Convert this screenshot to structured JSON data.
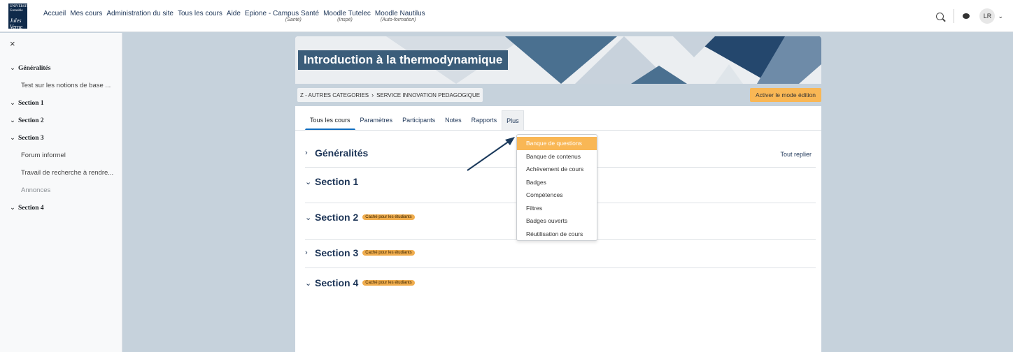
{
  "navbar": {
    "logo_line1": "UNIVERSITÉ Grenoble",
    "logo_line2": "Jules Verne",
    "items": [
      {
        "label": "Accueil",
        "sub": ""
      },
      {
        "label": "Mes cours",
        "sub": ""
      },
      {
        "label": "Administration du site",
        "sub": ""
      },
      {
        "label": "Tous les cours",
        "sub": ""
      },
      {
        "label": "Aide",
        "sub": ""
      },
      {
        "label": "Epione - Campus Santé",
        "sub": "(Santé)"
      },
      {
        "label": "Moodle Tutelec",
        "sub": "(Inspé)"
      },
      {
        "label": "Moodle Nautilus",
        "sub": "(Auto-formation)"
      }
    ],
    "user_initials": "LR",
    "icons": [
      "search-icon",
      "chat-icon",
      "chevron-down-icon"
    ]
  },
  "drawer": {
    "close_glyph": "×",
    "items": [
      {
        "label": "Généralités",
        "type": "section"
      },
      {
        "label": "Test sur les notions de base ...",
        "type": "activity"
      },
      {
        "label": "Section 1",
        "type": "section"
      },
      {
        "label": "Section 2",
        "type": "section"
      },
      {
        "label": "Section 3",
        "type": "section"
      },
      {
        "label": "Forum informel",
        "type": "activity"
      },
      {
        "label": "Travail de recherche à rendre...",
        "type": "activity"
      },
      {
        "label": "Annonces",
        "type": "muted"
      },
      {
        "label": "Section 4",
        "type": "section"
      }
    ]
  },
  "course": {
    "title": "Introduction à la thermodynamique",
    "breadcrumb": [
      "Z - AUTRES CATEGORIES",
      "SERVICE INNOVATION PEDAGOGIQUE"
    ],
    "edit_button": "Activer le mode édition",
    "tabs": [
      {
        "label": "Tous les cours"
      },
      {
        "label": "Paramètres"
      },
      {
        "label": "Participants"
      },
      {
        "label": "Notes"
      },
      {
        "label": "Rapports"
      },
      {
        "label": "Plus"
      }
    ],
    "collapse_all": "Tout replier",
    "sections": [
      {
        "name": "Généralités",
        "expanded": false,
        "badge": ""
      },
      {
        "name": "Section 1",
        "expanded": true,
        "badge": ""
      },
      {
        "name": "Section 2",
        "expanded": true,
        "badge": "Caché pour les étudiants"
      },
      {
        "name": "Section 3",
        "expanded": false,
        "badge": "Caché pour les étudiants"
      },
      {
        "name": "Section 4",
        "expanded": true,
        "badge": "Caché pour les étudiants"
      }
    ]
  },
  "dropdown": {
    "items": [
      {
        "label": "Banque de questions",
        "active": true
      },
      {
        "label": "Banque de contenus",
        "active": false
      },
      {
        "label": "Achèvement de cours",
        "active": false
      },
      {
        "label": "Badges",
        "active": false
      },
      {
        "label": "Compétences",
        "active": false
      },
      {
        "label": "Filtres",
        "active": false
      },
      {
        "label": "Badges ouverts",
        "active": false
      },
      {
        "label": "Réutilisation de cours",
        "active": false
      }
    ]
  },
  "colors": {
    "accent_orange": "#f9b755",
    "badge_orange": "#f0ad4e",
    "title_blue": "#3b5d7a",
    "page_bg": "#c6d2dc",
    "link_navy": "#1d3557"
  }
}
